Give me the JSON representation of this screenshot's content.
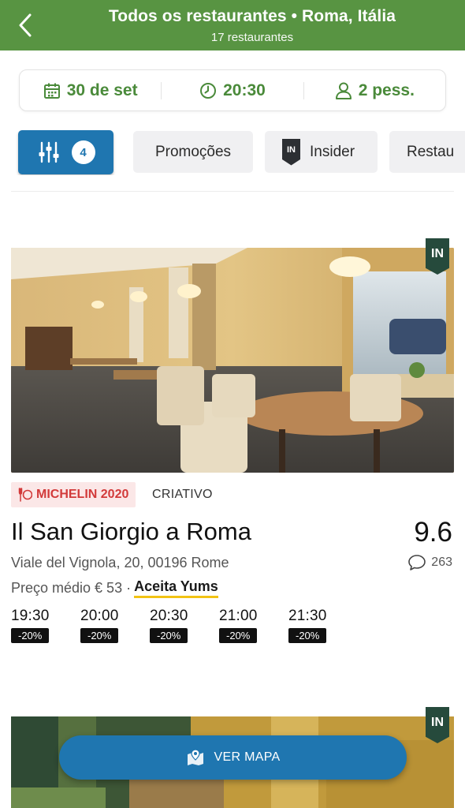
{
  "header": {
    "title": "Todos os restaurantes • Roma, Itália",
    "subtitle": "17 restaurantes",
    "color": "#589442"
  },
  "booking": {
    "date": "30 de set",
    "time": "20:30",
    "people": "2 pess."
  },
  "filters": {
    "active_count": "4",
    "chips": [
      "Promoções",
      "Insider",
      "Restau"
    ],
    "insider_badge": "IN"
  },
  "restaurants": [
    {
      "insider_tag": "IN",
      "michelin": "MICHELIN 2020",
      "cuisine": "CRIATIVO",
      "name": "Il San Giorgio a Roma",
      "score": "9.6",
      "address": "Viale del Vignola, 20, 00196 Rome",
      "reviews": "263",
      "price_label": "Preço médio € 53 ·",
      "yums": "Aceita Yums",
      "slots": [
        {
          "time": "19:30",
          "discount": "-20%"
        },
        {
          "time": "20:00",
          "discount": "-20%"
        },
        {
          "time": "20:30",
          "discount": "-20%"
        },
        {
          "time": "21:00",
          "discount": "-20%"
        },
        {
          "time": "21:30",
          "discount": "-20%"
        }
      ]
    },
    {
      "insider_tag": "IN"
    }
  ],
  "map_button": {
    "label": "VER MAPA",
    "color": "#1f76b0"
  }
}
